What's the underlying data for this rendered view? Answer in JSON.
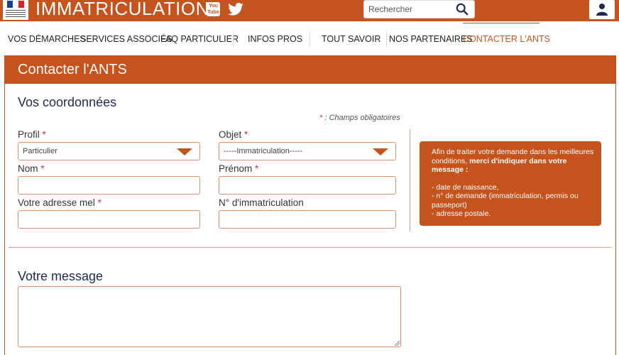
{
  "header": {
    "brand": "IMMATRICULATION",
    "logo_icon": "republique-francaise-logo",
    "youtube_icon_text": "You Tube",
    "search_placeholder": "Rechercher"
  },
  "nav": {
    "items": [
      {
        "label": "VOS DÉMARCHES"
      },
      {
        "label": "SERVICES ASSOCIÉS"
      },
      {
        "label": "FAQ PARTICULIER"
      },
      {
        "label": "INFOS PROS"
      },
      {
        "label": "TOUT SAVOIR"
      },
      {
        "label": "NOS PARTENAIRES"
      },
      {
        "label": "CONTACTER L'ANTS"
      }
    ]
  },
  "page": {
    "title": "Contacter l'ANTS",
    "section_coords": "Vos coordonnées",
    "required_note": ": Champs obligatoires",
    "required_star": "*",
    "section_message": "Votre message"
  },
  "form": {
    "profil_label": "Profil",
    "profil_value": "Particulier",
    "objet_label": "Objet",
    "objet_value": "-----Immatriculation-----",
    "nom_label": "Nom",
    "prenom_label": "Prénom",
    "email_label": "Votre adresse mel",
    "immat_label": "N° d'immatriculation",
    "nom_value": "",
    "prenom_value": "",
    "email_value": "",
    "immat_value": "",
    "message_value": ""
  },
  "info": {
    "intro": "Afin de traiter votre demande dans les meilleures conditions,",
    "intro_bold": "merci d'indiquer dans votre message :",
    "items": [
      "- date de naissance,",
      "- n° de demande (immatriculation, permis ou passeport)",
      "- adresse postale."
    ]
  },
  "colors": {
    "brand": "#c5531d",
    "heading": "#1d2b53",
    "required": "#c0392b"
  }
}
